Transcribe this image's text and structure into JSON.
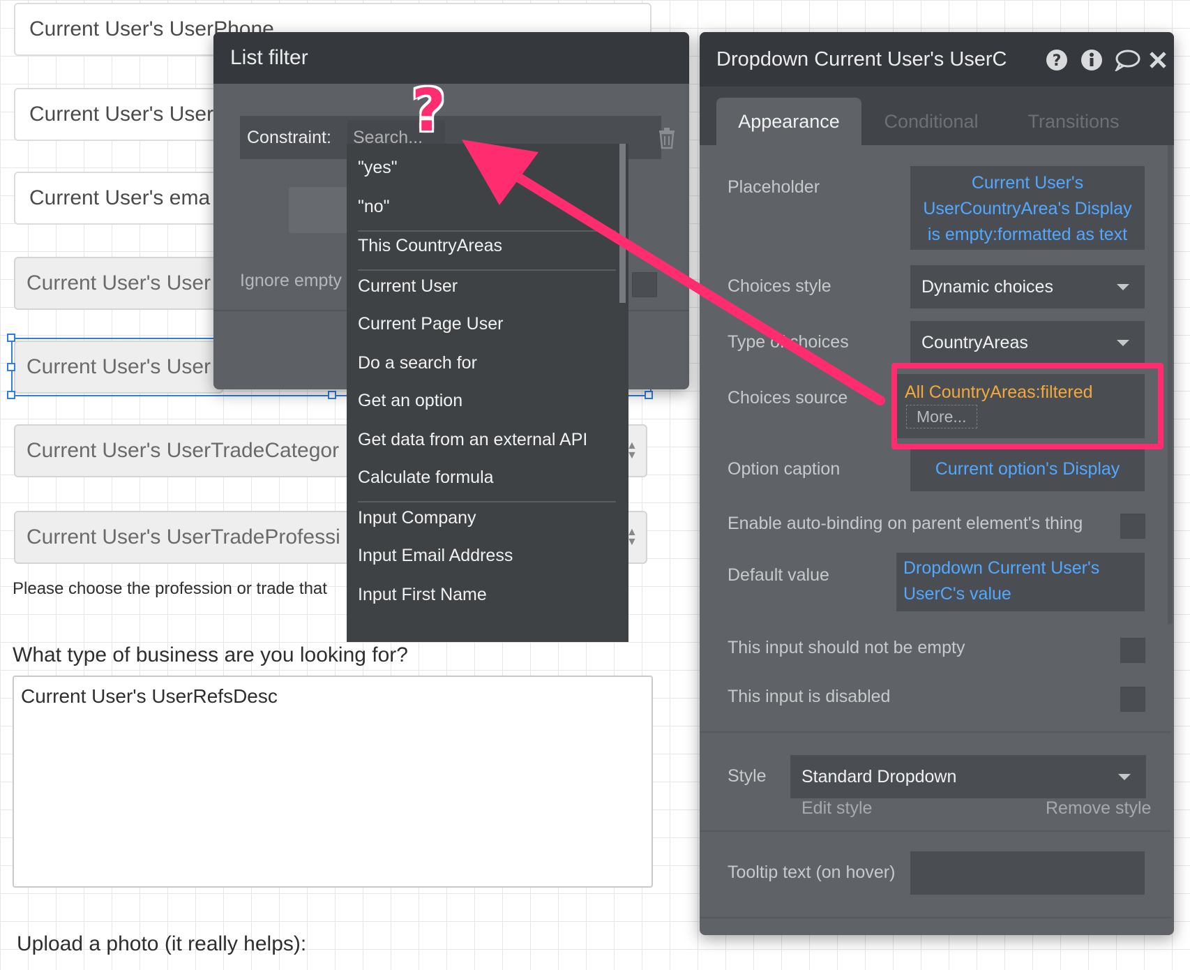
{
  "canvas": {
    "fields": [
      "Current User's UserPhone",
      "Current User's User",
      "Current User's ema",
      "Current User's User",
      "Current User's User",
      "Current User's UserTradeCategor",
      "Current User's UserTradeProfessi"
    ],
    "hint_text": "Please choose the profession or trade that",
    "question_label": "What type of business are you looking for?",
    "textarea_value": "Current User's UserRefsDesc",
    "upload_label": "Upload a photo (it really helps):"
  },
  "list_filter": {
    "title": "List filter",
    "constraint_label": "Constraint:",
    "search_placeholder": "Search...",
    "ignore_empty_label": "Ignore empty",
    "options": [
      "\"yes\"",
      "\"no\"",
      "This CountryAreas",
      "Current User",
      "Current Page User",
      "Do a search for",
      "Get an option",
      "Get data from an external API",
      "Calculate formula",
      "Input Company",
      "Input Email Address",
      "Input First Name"
    ]
  },
  "annotation": {
    "question_mark": "?",
    "arrow_color": "#ff2d6f",
    "highlight_color": "#ff2d6f"
  },
  "property_editor": {
    "title": "Dropdown Current User's UserC",
    "header_icons": [
      "help-icon",
      "info-icon",
      "comment-icon",
      "close-icon"
    ],
    "tabs": [
      "Appearance",
      "Conditional",
      "Transitions"
    ],
    "active_tab": "Appearance",
    "placeholder": {
      "label": "Placeholder",
      "value": "Current User's UserCountryArea's Display is empty:formatted as text"
    },
    "choices_style": {
      "label": "Choices style",
      "value": "Dynamic choices"
    },
    "type_of_choices": {
      "label": "Type of choices",
      "value": "CountryAreas"
    },
    "choices_source": {
      "label": "Choices source",
      "value": "All CountryAreas:filtered",
      "more": "More..."
    },
    "option_caption": {
      "label": "Option caption",
      "value": "Current option's Display"
    },
    "auto_binding": {
      "label": "Enable auto-binding on parent element's thing"
    },
    "default_value": {
      "label": "Default value",
      "value": "Dropdown Current User's UserC's value"
    },
    "not_empty": {
      "label": "This input should not be empty"
    },
    "disabled": {
      "label": "This input is disabled"
    },
    "style": {
      "label": "Style",
      "value": "Standard Dropdown",
      "edit": "Edit style",
      "remove": "Remove style"
    },
    "tooltip": {
      "label": "Tooltip text (on hover)",
      "value": ""
    },
    "colors": {
      "dynamic_text": "#52a8ff",
      "source_text": "#f2a93b"
    }
  }
}
